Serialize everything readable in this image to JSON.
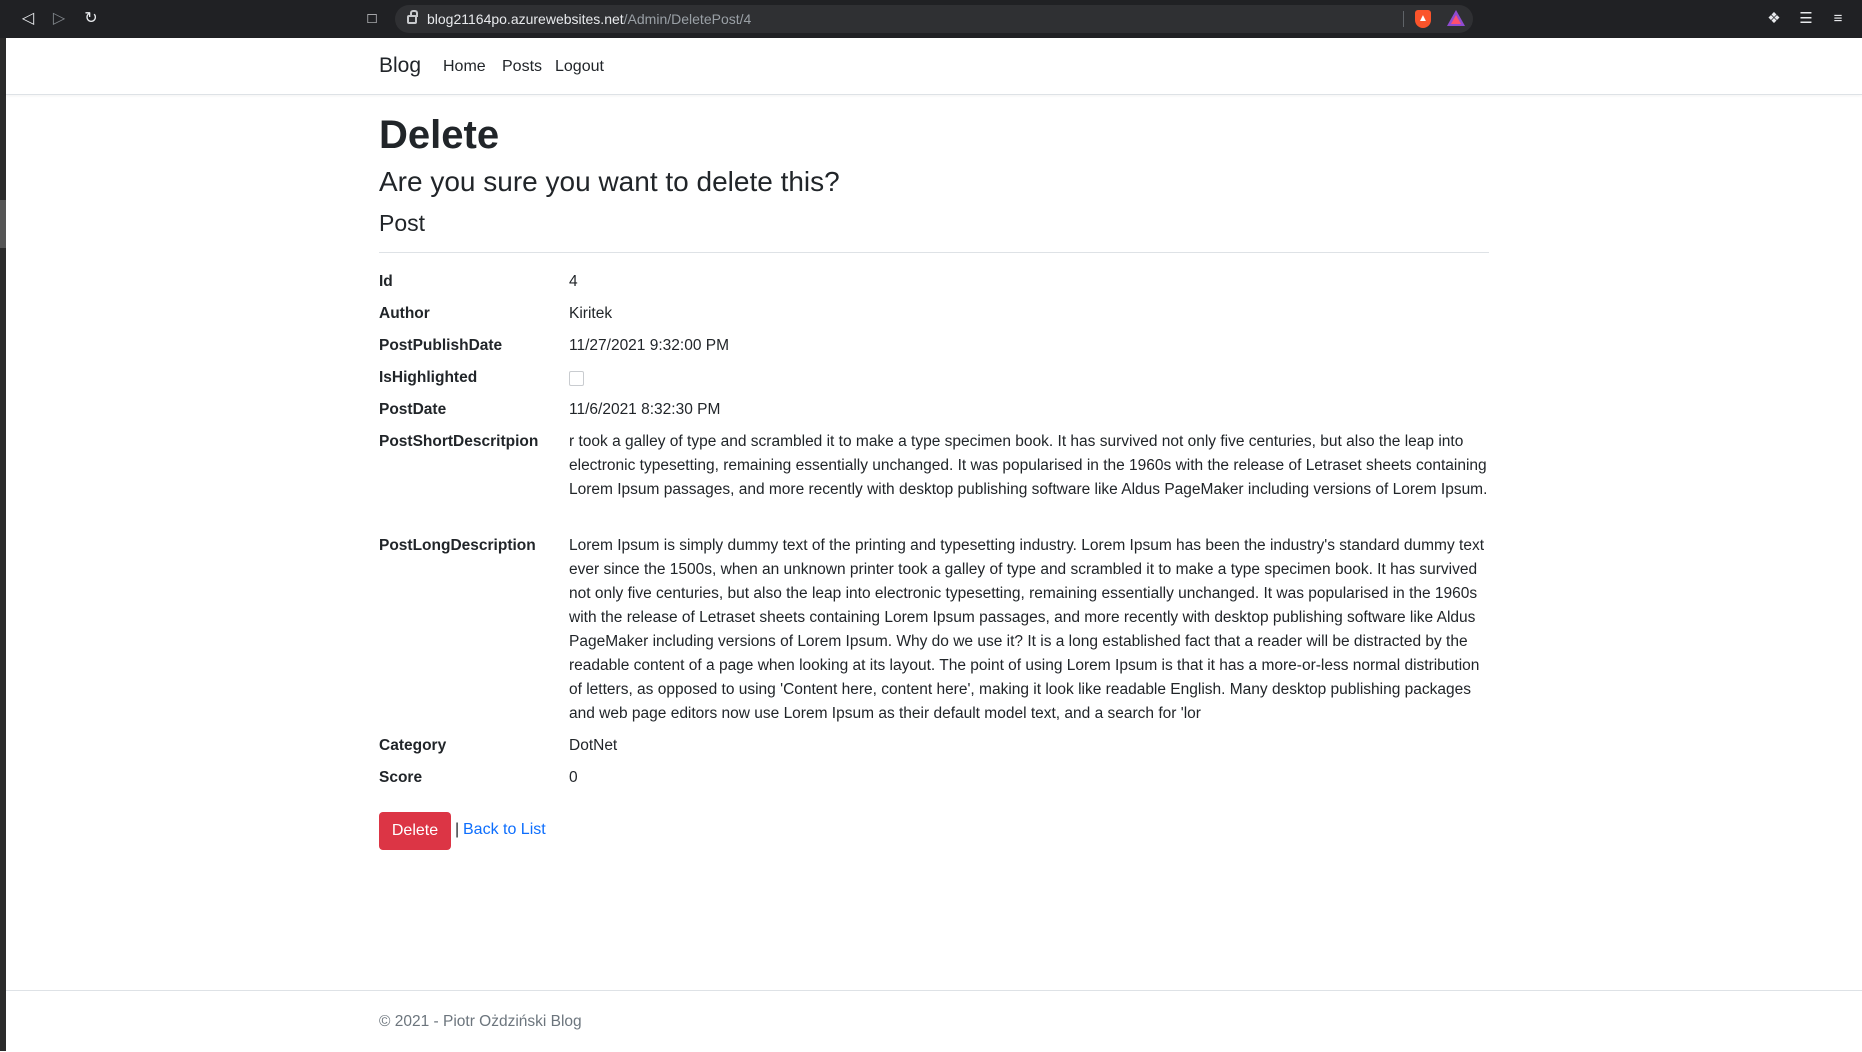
{
  "browser": {
    "url_host": "blog21164po.azurewebsites.net",
    "url_path": "/Admin/DeletePost/4",
    "icons": [
      "back-icon",
      "forward-icon",
      "reload-icon",
      "bookmark-icon",
      "lock-icon",
      "brave-shield-icon",
      "brave-rewards-icon",
      "extensions-icon",
      "playlist-icon",
      "menu-icon"
    ]
  },
  "navbar": {
    "brand": "Blog",
    "links": [
      "Home",
      "Posts",
      "Logout"
    ]
  },
  "page": {
    "title": "Delete",
    "question": "Are you sure you want to delete this?",
    "entity": "Post"
  },
  "fields": [
    {
      "label": "Id",
      "value": "4"
    },
    {
      "label": "Author",
      "value": "Kiritek"
    },
    {
      "label": "PostPublishDate",
      "value": "11/27/2021 9:32:00 PM"
    },
    {
      "label": "IsHighlighted",
      "value": false
    },
    {
      "label": "PostDate",
      "value": "11/6/2021 8:32:30 PM"
    },
    {
      "label": "PostShortDescritpion",
      "value": "r took a galley of type and scrambled it to make a type specimen book. It has survived not only five centuries, but also the leap into electronic typesetting, remaining essentially unchanged. It was popularised in the 1960s with the release of Letraset sheets containing Lorem Ipsum passages, and more recently with desktop publishing software like Aldus PageMaker including versions of Lorem Ipsum."
    },
    {
      "label": "PostLongDescription",
      "value": "Lorem Ipsum is simply dummy text of the printing and typesetting industry. Lorem Ipsum has been the industry's standard dummy text ever since the 1500s, when an unknown printer took a galley of type and scrambled it to make a type specimen book. It has survived not only five centuries, but also the leap into electronic typesetting, remaining essentially unchanged. It was popularised in the 1960s with the release of Letraset sheets containing Lorem Ipsum passages, and more recently with desktop publishing software like Aldus PageMaker including versions of Lorem Ipsum. Why do we use it? It is a long established fact that a reader will be distracted by the readable content of a page when looking at its layout. The point of using Lorem Ipsum is that it has a more-or-less normal distribution of letters, as opposed to using 'Content here, content here', making it look like readable English. Many desktop publishing packages and web page editors now use Lorem Ipsum as their default model text, and a search for 'lor"
    },
    {
      "label": "Category",
      "value": "DotNet"
    },
    {
      "label": "Score",
      "value": "0"
    }
  ],
  "actions": {
    "delete_label": "Delete",
    "separator": "|",
    "back_label": "Back to List"
  },
  "footer": {
    "text": "© 2021 - Piotr Ożdziński Blog"
  },
  "colors": {
    "danger": "#dc3545",
    "link": "#0d6efd",
    "chrome": "#202124"
  }
}
